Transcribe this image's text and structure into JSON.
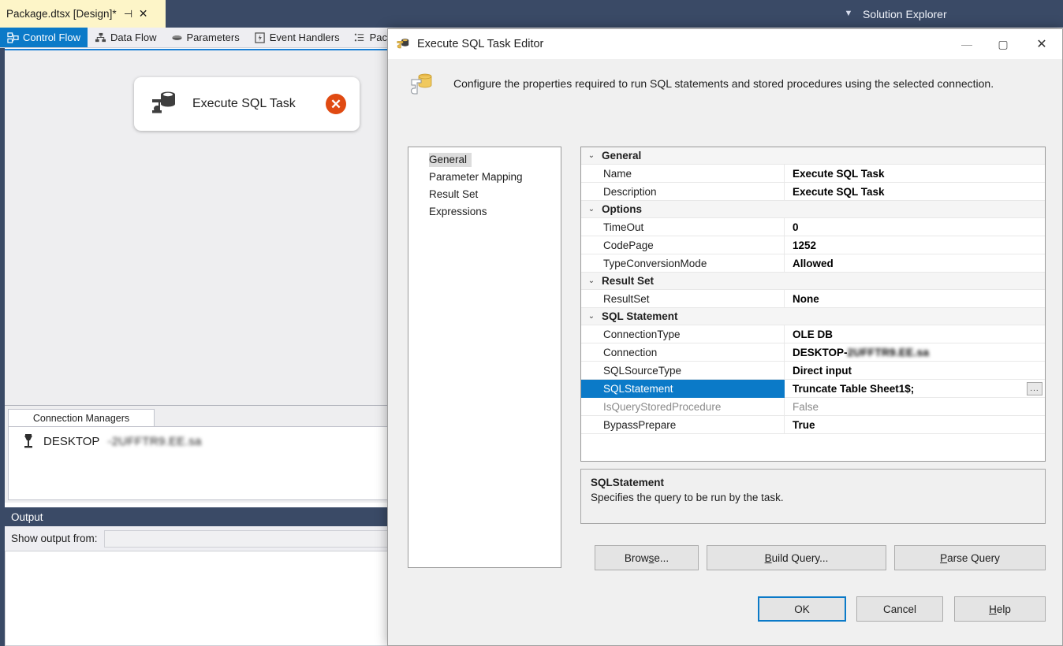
{
  "shell": {
    "document_tab": {
      "title": "Package.dtsx [Design]*",
      "pin_icon": "pin-icon",
      "close_icon": "close-icon"
    },
    "topbar_chevron_icon": "chevron-down-icon",
    "solution_explorer": {
      "title": "Solution Explorer"
    },
    "view_tabs": [
      {
        "label": "Control Flow",
        "icon": "control-flow-icon",
        "active": true
      },
      {
        "label": "Data Flow",
        "icon": "data-flow-icon",
        "active": false
      },
      {
        "label": "Parameters",
        "icon": "parameters-icon",
        "active": false
      },
      {
        "label": "Event Handlers",
        "icon": "event-handlers-icon",
        "active": false
      },
      {
        "label": "Pac",
        "icon": "package-explorer-icon",
        "active": false
      }
    ],
    "designer": {
      "task": {
        "label": "Execute SQL Task",
        "icon": "execute-sql-task-icon",
        "error_badge_icon": "error-x-icon",
        "error_badge_glyph": "✕"
      }
    },
    "connection_managers": {
      "tab_label": "Connection Managers",
      "items": [
        {
          "icon": "connection-icon",
          "label": "DESKTOP",
          "blurred_suffix": "-2UFFTR9.EE.sa"
        }
      ]
    },
    "output": {
      "title": "Output",
      "show_output_from_label": "Show output from:",
      "show_output_from_value": ""
    }
  },
  "dialog": {
    "title": "Execute SQL Task Editor",
    "title_icon": "execute-sql-task-icon",
    "window_buttons": {
      "minimize": "—",
      "maximize": "▢",
      "close": "✕"
    },
    "banner": {
      "icon": "execute-sql-task-large-icon",
      "text": "Configure the properties required to run SQL statements and stored procedures using the selected connection."
    },
    "nav": {
      "items": [
        {
          "label": "General",
          "selected": true
        },
        {
          "label": "Parameter Mapping",
          "selected": false
        },
        {
          "label": "Result Set",
          "selected": false
        },
        {
          "label": "Expressions",
          "selected": false
        }
      ]
    },
    "property_grid": {
      "groups": [
        {
          "category": "General",
          "expanded": true,
          "rows": [
            {
              "name": "Name",
              "value": "Execute SQL Task",
              "state": "normal"
            },
            {
              "name": "Description",
              "value": "Execute SQL Task",
              "state": "normal"
            }
          ]
        },
        {
          "category": "Options",
          "expanded": true,
          "rows": [
            {
              "name": "TimeOut",
              "value": "0",
              "state": "normal"
            },
            {
              "name": "CodePage",
              "value": "1252",
              "state": "normal"
            },
            {
              "name": "TypeConversionMode",
              "value": "Allowed",
              "state": "normal"
            }
          ]
        },
        {
          "category": "Result Set",
          "expanded": true,
          "rows": [
            {
              "name": "ResultSet",
              "value": "None",
              "state": "normal"
            }
          ]
        },
        {
          "category": "SQL Statement",
          "expanded": true,
          "rows": [
            {
              "name": "ConnectionType",
              "value": "OLE DB",
              "state": "normal"
            },
            {
              "name": "Connection",
              "value": "DESKTOP-",
              "value_blurred": "2UFFTR9.EE.sa",
              "state": "normal"
            },
            {
              "name": "SQLSourceType",
              "value": "Direct input",
              "state": "normal"
            },
            {
              "name": "SQLStatement",
              "value": "Truncate Table Sheet1$;",
              "state": "selected",
              "has_ellipsis": true,
              "ellipsis_label": "..."
            },
            {
              "name": "IsQueryStoredProcedure",
              "value": "False",
              "state": "dim"
            },
            {
              "name": "BypassPrepare",
              "value": "True",
              "state": "normal"
            }
          ]
        }
      ]
    },
    "help_pane": {
      "title": "SQLStatement",
      "description": "Specifies the query to be run by the task."
    },
    "action_buttons": [
      {
        "name": "browse",
        "pre": "Brow",
        "mnemonic": "s",
        "post": "e..."
      },
      {
        "name": "build-query",
        "pre": "",
        "mnemonic": "B",
        "post": "uild Query..."
      },
      {
        "name": "parse-query",
        "pre": "",
        "mnemonic": "P",
        "post": "arse Query"
      }
    ],
    "footer_buttons": [
      {
        "name": "ok",
        "pre": "OK",
        "mnemonic": "",
        "post": "",
        "default": true
      },
      {
        "name": "cancel",
        "pre": "Cancel",
        "mnemonic": "",
        "post": "",
        "default": false
      },
      {
        "name": "help",
        "pre": "",
        "mnemonic": "H",
        "post": "elp",
        "default": false
      }
    ]
  },
  "colors": {
    "accent_blue": "#0b7ac8",
    "vs_chrome": "#3a4a66",
    "tab_yellow": "#fdf5c8",
    "error_orange": "#e04a12",
    "dialog_bg": "#f0f0f0"
  }
}
